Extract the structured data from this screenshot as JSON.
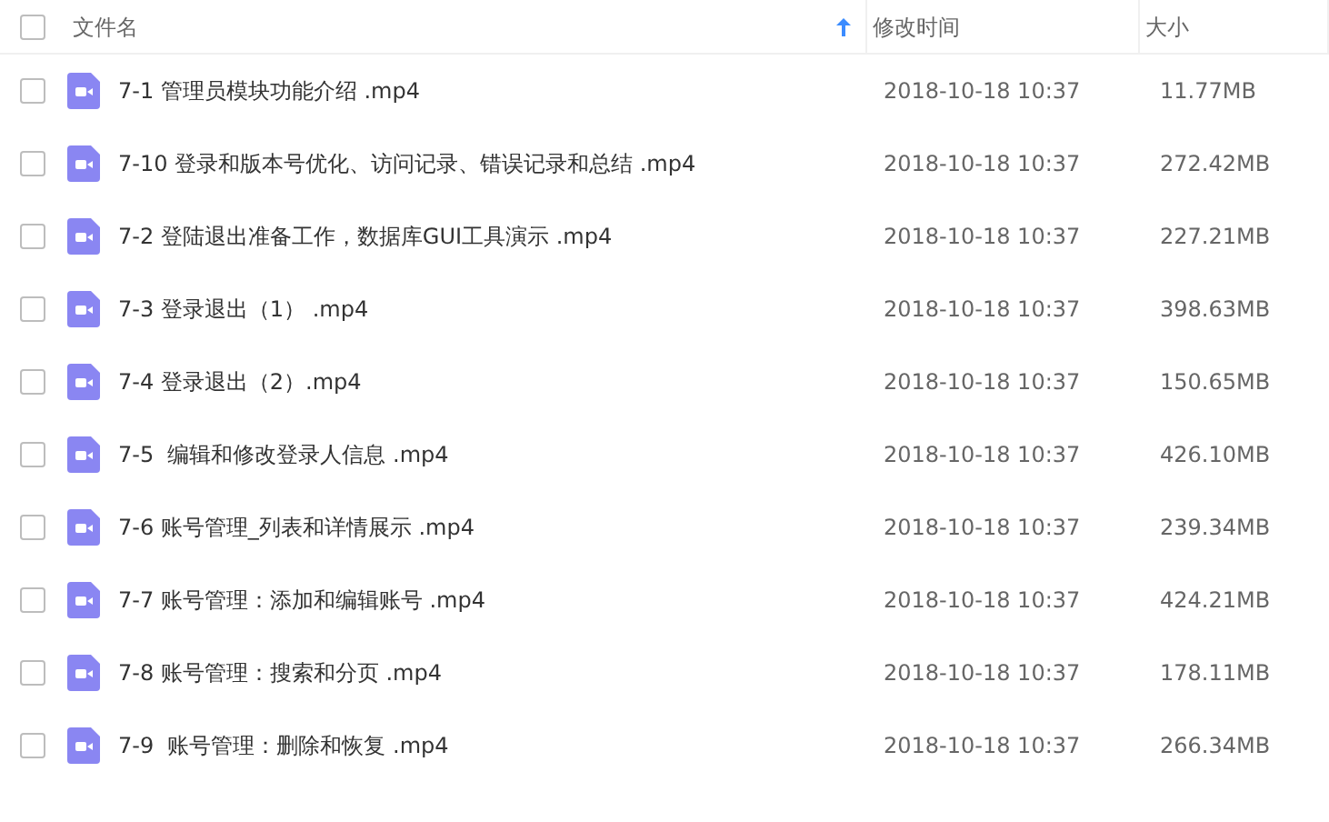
{
  "header": {
    "checked": false,
    "columns": [
      {
        "label": "文件名",
        "sorted": true
      },
      {
        "label": "修改时间",
        "sorted": false
      },
      {
        "label": "大小",
        "sorted": false
      }
    ]
  },
  "rows": [
    {
      "checked": false,
      "name": "7-1 管理员模块功能介绍 .mp4",
      "modified": "2018-10-18 10:37",
      "size": "11.77MB"
    },
    {
      "checked": false,
      "name": "7-10 登录和版本号优化、访问记录、错误记录和总结 .mp4",
      "modified": "2018-10-18 10:37",
      "size": "272.42MB"
    },
    {
      "checked": false,
      "name": "7-2 登陆退出准备工作，数据库GUI工具演示 .mp4",
      "modified": "2018-10-18 10:37",
      "size": "227.21MB"
    },
    {
      "checked": false,
      "name": "7-3 登录退出（1） .mp4",
      "modified": "2018-10-18 10:37",
      "size": "398.63MB"
    },
    {
      "checked": false,
      "name": "7-4 登录退出（2）.mp4",
      "modified": "2018-10-18 10:37",
      "size": "150.65MB"
    },
    {
      "checked": false,
      "name": "7-5  编辑和修改登录人信息 .mp4",
      "modified": "2018-10-18 10:37",
      "size": "426.10MB"
    },
    {
      "checked": false,
      "name": "7-6 账号管理_列表和详情展示 .mp4",
      "modified": "2018-10-18 10:37",
      "size": "239.34MB"
    },
    {
      "checked": false,
      "name": "7-7 账号管理：添加和编辑账号 .mp4",
      "modified": "2018-10-18 10:37",
      "size": "424.21MB"
    },
    {
      "checked": false,
      "name": "7-8 账号管理：搜索和分页 .mp4",
      "modified": "2018-10-18 10:37",
      "size": "178.11MB"
    },
    {
      "checked": false,
      "name": "7-9  账号管理：删除和恢复 .mp4",
      "modified": "2018-10-18 10:37",
      "size": "266.34MB"
    }
  ]
}
